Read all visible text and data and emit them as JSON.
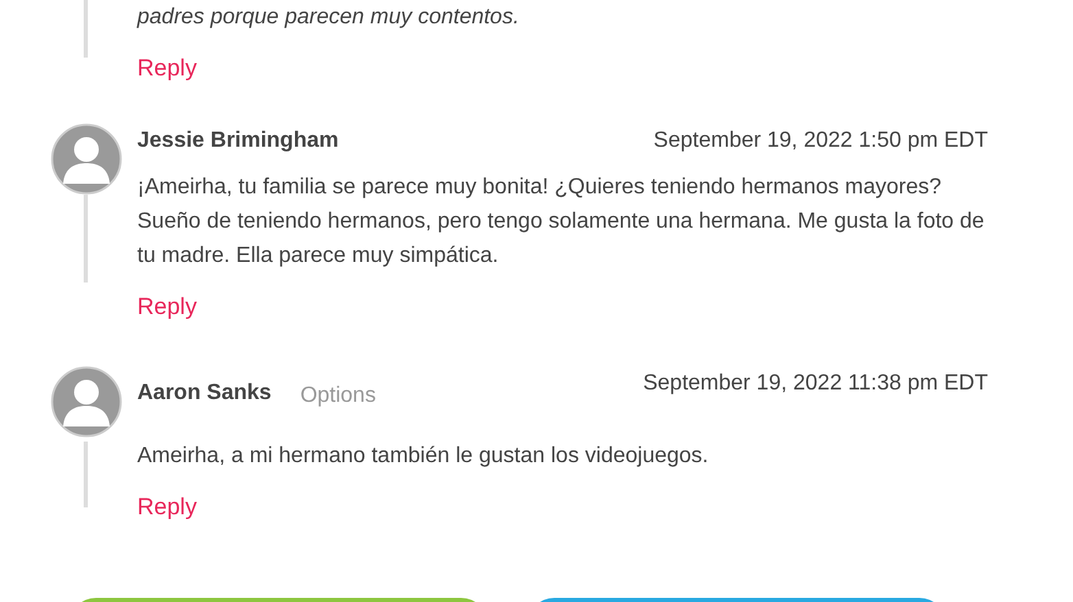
{
  "thread_fragment": {
    "text": "padres porque parecen muy contentos.",
    "reply": "Reply"
  },
  "comments": [
    {
      "author": "Jessie Brimingham",
      "date": "September 19, 2022 1:50 pm EDT",
      "body": "¡Ameirha, tu familia se parece muy bonita! ¿Quieres teniendo hermanos mayores? Sueño de teniendo hermanos, pero tengo solamente una hermana. Me gusta la foto de tu madre. Ella parece muy simpática.",
      "reply": "Reply"
    },
    {
      "author": "Aaron Sanks",
      "options": "Options",
      "date": "September 19, 2022 11:38 pm EDT",
      "body": "Ameirha, a mi hermano también le gustan los videojuegos.",
      "reply": "Reply"
    }
  ],
  "bottom_buttons": [
    {
      "color": "#8dc63f"
    },
    {
      "color": "#29a9e1"
    }
  ]
}
